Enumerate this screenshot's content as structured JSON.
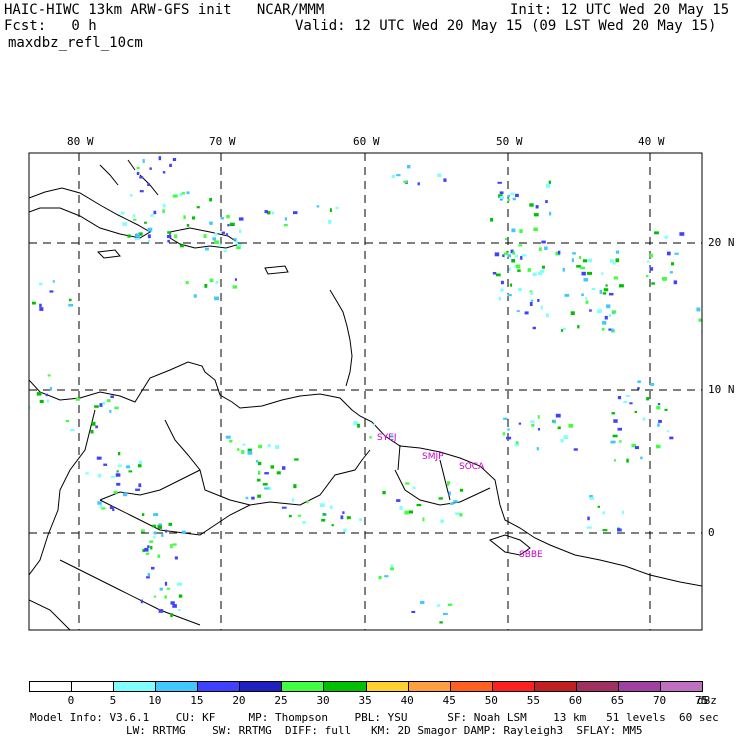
{
  "header": {
    "title": "HAIC-HIWC 13km ARW-GFS init   NCAR/MMM",
    "fcst": "Fcst:   0 h",
    "field": "maxdbz_refl_10cm",
    "init": "Init: 12 UTC Wed 20 May 15",
    "valid": "Valid: 12 UTC Wed 20 May 15 (09 LST Wed 20 May 15)"
  },
  "map": {
    "lon_labels": [
      "80 W",
      "70 W",
      "60 W",
      "50 W",
      "40 W"
    ],
    "lat_labels": [
      "20 N",
      "10 N",
      "0"
    ],
    "stations": [
      "SYEJ",
      "SMJP",
      "SOCA",
      "SBBE"
    ],
    "station_color": "#cc00cc"
  },
  "colorbar": {
    "ticks": [
      "0",
      "5",
      "10",
      "15",
      "20",
      "25",
      "30",
      "35",
      "40",
      "45",
      "50",
      "55",
      "60",
      "65",
      "70",
      "75"
    ],
    "unit": "dBz",
    "colors": [
      "#ffffff",
      "#ffffff",
      "#80ffff",
      "#40c8ff",
      "#4040ff",
      "#2020c0",
      "#40ff40",
      "#00c000",
      "#ffd030",
      "#ffa040",
      "#ff6020",
      "#ff2020",
      "#c02020",
      "#a03060",
      "#a040a0",
      "#c070c0"
    ]
  },
  "model_info": {
    "line1": "Model Info: V3.6.1    CU: KF     MP: Thompson    PBL: YSU      SF: Noah LSM    13 km   51 levels  60 sec",
    "line2": "LW: RRTMG    SW: RRTMG  DIFF: full   KM: 2D Smagor DAMP: Rayleigh3  SFLAY: MM5"
  }
}
